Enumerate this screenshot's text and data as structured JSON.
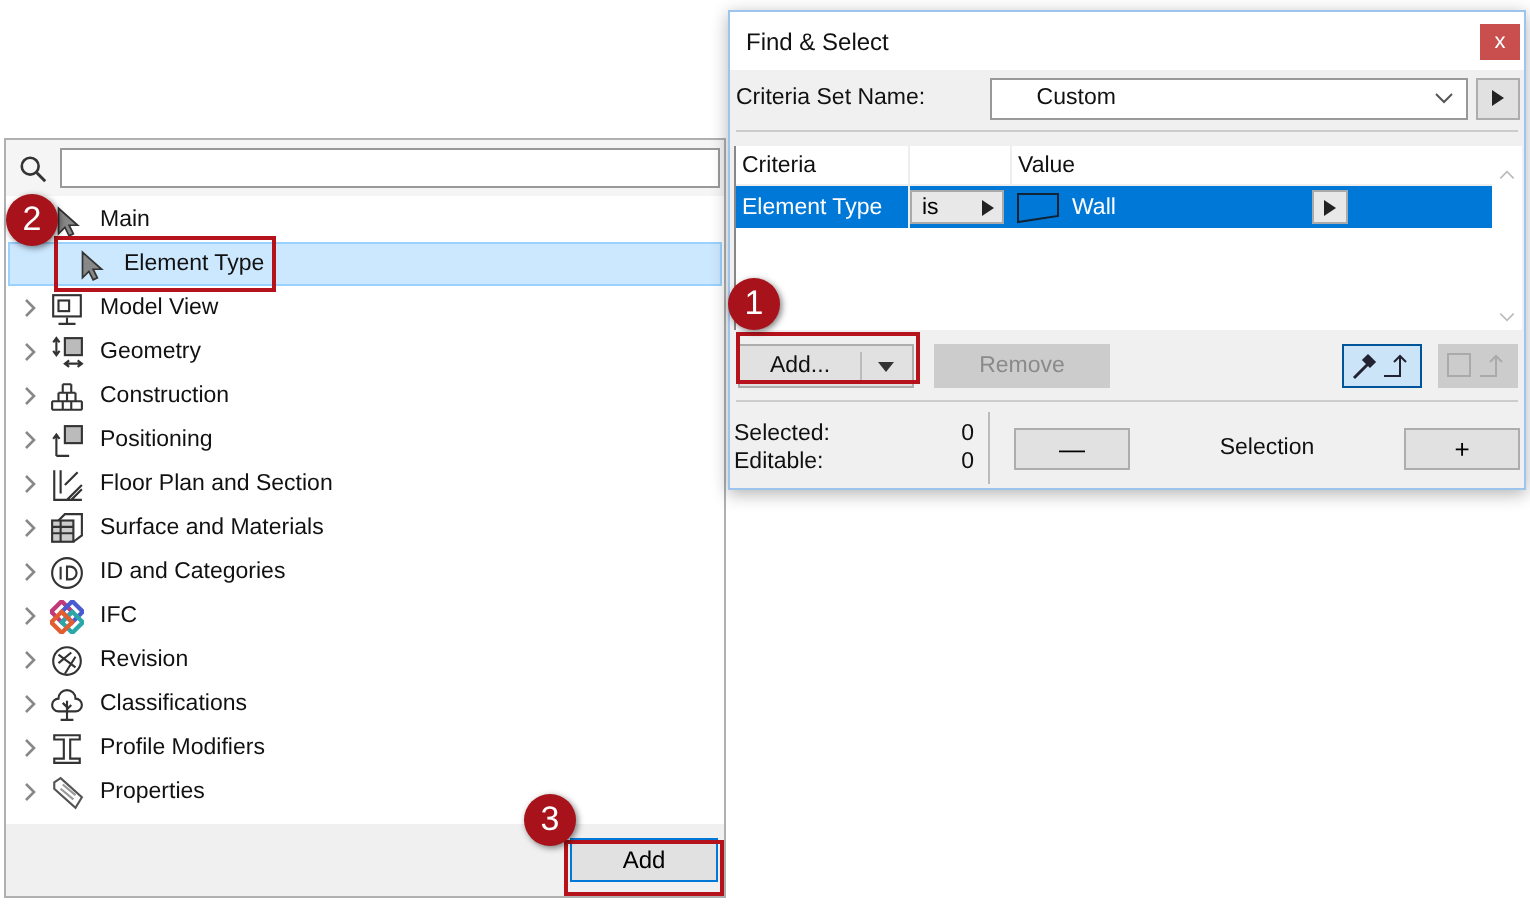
{
  "tree_panel": {
    "items": [
      {
        "label": "Main",
        "expanded": true,
        "selected": false,
        "children": [
          {
            "label": "Element Type",
            "selected": true
          }
        ]
      },
      {
        "label": "Model View",
        "expanded": false,
        "selected": false
      },
      {
        "label": "Geometry",
        "expanded": false,
        "selected": false
      },
      {
        "label": "Construction",
        "expanded": false,
        "selected": false
      },
      {
        "label": "Positioning",
        "expanded": false,
        "selected": false
      },
      {
        "label": "Floor Plan and Section",
        "expanded": false,
        "selected": false
      },
      {
        "label": "Surface and Materials",
        "expanded": false,
        "selected": false
      },
      {
        "label": "ID and Categories",
        "expanded": false,
        "selected": false
      },
      {
        "label": "IFC",
        "expanded": false,
        "selected": false
      },
      {
        "label": "Revision",
        "expanded": false,
        "selected": false
      },
      {
        "label": "Classifications",
        "expanded": false,
        "selected": false
      },
      {
        "label": "Profile Modifiers",
        "expanded": false,
        "selected": false
      },
      {
        "label": "Properties",
        "expanded": false,
        "selected": false
      }
    ],
    "add_button": "Add"
  },
  "dialog": {
    "title": "Find & Select",
    "close": "x",
    "criteria_set_label": "Criteria Set Name:",
    "criteria_set_value": "Custom",
    "columns": {
      "criteria": "Criteria",
      "value": "Value"
    },
    "rows": [
      {
        "criteria": "Element Type",
        "operator": "is",
        "value": "Wall",
        "selected": true
      }
    ],
    "add_button": "Add...",
    "remove_button": {
      "label": "Remove",
      "disabled": true
    },
    "tool_buttons": [
      {
        "selected": true,
        "disabled": false
      },
      {
        "selected": false,
        "disabled": true
      }
    ],
    "counts": [
      {
        "label": "Selected:",
        "value": "0"
      },
      {
        "label": "Editable:",
        "value": "0"
      }
    ],
    "minus": "—",
    "selection_label": "Selection",
    "plus": "+"
  },
  "callouts": [
    {
      "number": "1"
    },
    {
      "number": "2"
    },
    {
      "number": "3"
    }
  ]
}
